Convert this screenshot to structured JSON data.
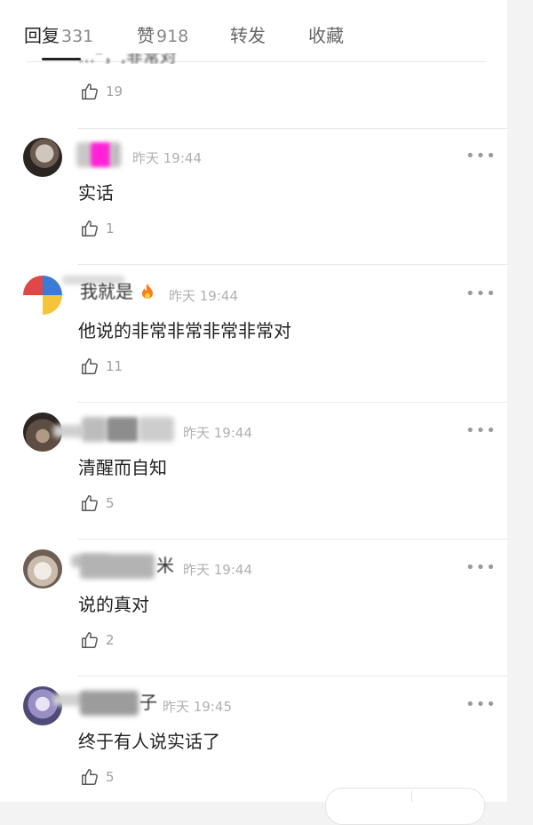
{
  "tabs": [
    {
      "label": "回复",
      "count": "331"
    },
    {
      "label": "赞",
      "count": "918"
    },
    {
      "label": "转发",
      "count": ""
    },
    {
      "label": "收藏",
      "count": ""
    }
  ],
  "top_comment": {
    "text_fragment": "…”，,非常对",
    "likes": "19"
  },
  "comments": [
    {
      "name": "",
      "time": "昨天 19:44",
      "text": "实话",
      "likes": "1"
    },
    {
      "name": "我就是",
      "time": "昨天 19:44",
      "text": "他说的非常非常非常非常对",
      "likes": "11"
    },
    {
      "name": "",
      "time": "昨天 19:44",
      "text": "清醒而自知",
      "likes": "5"
    },
    {
      "name": "米",
      "time": "昨天 19:44",
      "text": "说的真对",
      "likes": "2"
    },
    {
      "name": "子",
      "time": "昨天 19:45",
      "text": "终于有人说实话了",
      "likes": "5"
    }
  ],
  "icons": {
    "like": "thumbs-up-icon",
    "more": "more-dots-icon"
  },
  "more_glyph": "•••",
  "colors": {
    "accent": "#222222",
    "muted": "#b0b0b0",
    "fire": "#ff7a1a"
  }
}
